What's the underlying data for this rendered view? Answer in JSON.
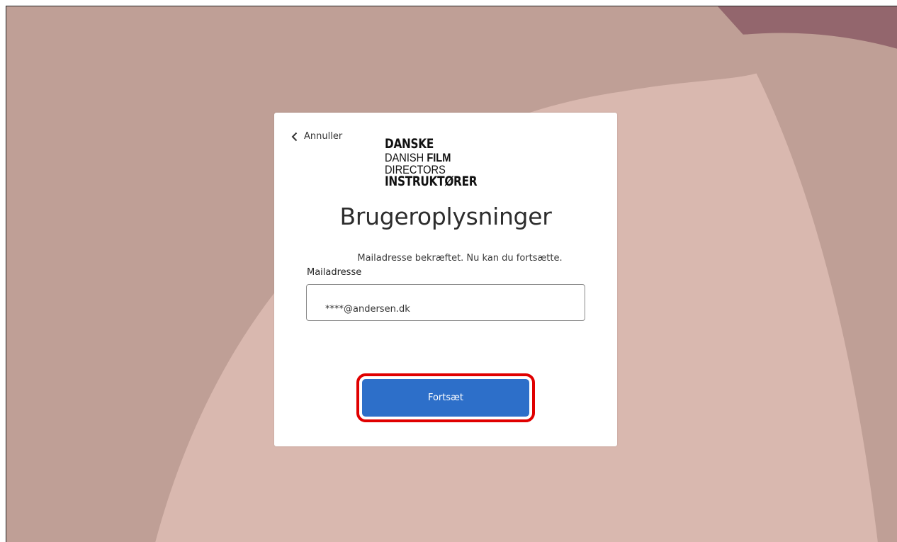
{
  "back": {
    "label": "Annuller",
    "icon": "chevron-left-icon"
  },
  "logo": {
    "line1": "DANSKE",
    "line2_pre": "DANISH ",
    "line2_bold": "FILM",
    "line2_post": " DIRECTORS",
    "line3": "INSTRUKTØRER"
  },
  "title": "Brugeroplysninger",
  "info_message": "Mailadresse bekræftet. Nu kan du fortsætte.",
  "email": {
    "label": "Mailadresse",
    "value": "****@andersen.dk"
  },
  "continue_button": {
    "label": "Fortsæt"
  },
  "colors": {
    "background": "#bf9f96",
    "light_shape": "#d9b8af",
    "dark_shape": "#93666d",
    "button": "#2d6fc9",
    "highlight": "#e00000"
  }
}
